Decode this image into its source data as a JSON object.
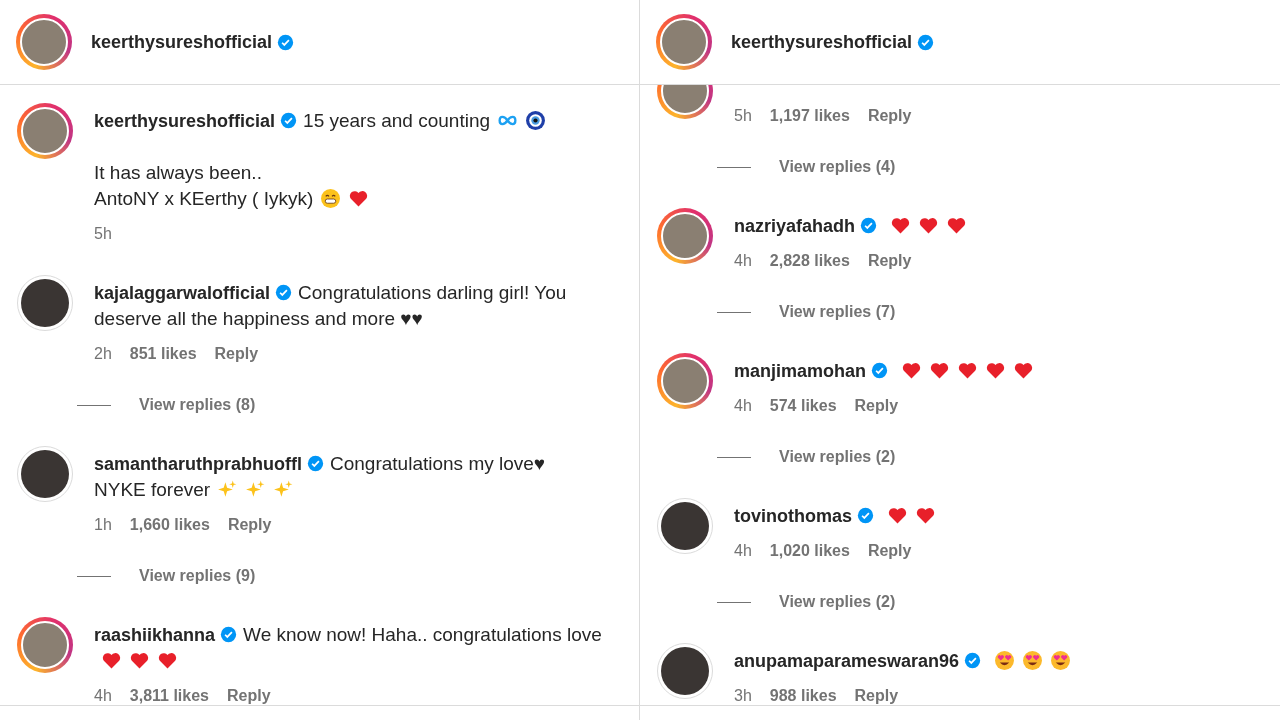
{
  "panels": [
    {
      "header": {
        "username": "keerthysureshofficial",
        "verified": true,
        "story_ring": true
      },
      "clipped_top": false,
      "comments": [
        {
          "username": "keerthysureshofficial",
          "verified": true,
          "story_ring": true,
          "body": [
            {
              "kind": "text",
              "text": "15 years and counting"
            },
            {
              "kind": "infinity"
            },
            {
              "kind": "evil-eye"
            },
            {
              "kind": "break"
            },
            {
              "kind": "break"
            },
            {
              "kind": "text",
              "text": "It has always been.."
            },
            {
              "kind": "break"
            },
            {
              "kind": "text",
              "text": "AntoNY x KEerthy ( Iykyk)"
            },
            {
              "kind": "grin"
            },
            {
              "kind": "heart"
            }
          ],
          "time": "5h"
        },
        {
          "username": "kajalaggarwalofficial",
          "verified": true,
          "story_ring": false,
          "body": [
            {
              "kind": "text",
              "text": "Congratulations darling girl! You deserve all the happiness and more ♥♥"
            }
          ],
          "time": "2h",
          "likes": "851 likes",
          "reply": "Reply",
          "view_replies": "View replies (8)"
        },
        {
          "username": "samantharuthprabhuoffl",
          "verified": true,
          "story_ring": false,
          "body": [
            {
              "kind": "text",
              "text": "Congratulations my love♥"
            },
            {
              "kind": "break"
            },
            {
              "kind": "text",
              "text": "NYKE forever"
            },
            {
              "kind": "sparkles"
            },
            {
              "kind": "sparkles"
            },
            {
              "kind": "sparkles"
            }
          ],
          "time": "1h",
          "likes": "1,660 likes",
          "reply": "Reply",
          "view_replies": "View replies (9)"
        },
        {
          "username": "raashiikhanna",
          "verified": true,
          "story_ring": true,
          "body": [
            {
              "kind": "text",
              "text": "We know now! Haha.. congratulations love"
            },
            {
              "kind": "heart"
            },
            {
              "kind": "heart"
            },
            {
              "kind": "heart"
            }
          ],
          "time": "4h",
          "likes": "3,811 likes",
          "reply": "Reply"
        }
      ]
    },
    {
      "header": {
        "username": "keerthysureshofficial",
        "verified": true,
        "story_ring": true
      },
      "clipped_top": true,
      "comments": [
        {
          "story_ring": true,
          "time": "5h",
          "likes": "1,197 likes",
          "reply": "Reply",
          "view_replies": "View replies (4)"
        },
        {
          "username": "nazriyafahadh",
          "verified": true,
          "story_ring": true,
          "body": [
            {
              "kind": "heart"
            },
            {
              "kind": "heart"
            },
            {
              "kind": "heart"
            }
          ],
          "time": "4h",
          "likes": "2,828 likes",
          "reply": "Reply",
          "view_replies": "View replies (7)"
        },
        {
          "username": "manjimamohan",
          "verified": true,
          "story_ring": true,
          "body": [
            {
              "kind": "heart"
            },
            {
              "kind": "heart"
            },
            {
              "kind": "heart"
            },
            {
              "kind": "heart"
            },
            {
              "kind": "heart"
            }
          ],
          "time": "4h",
          "likes": "574 likes",
          "reply": "Reply",
          "view_replies": "View replies (2)"
        },
        {
          "username": "tovinothomas",
          "verified": true,
          "story_ring": false,
          "body": [
            {
              "kind": "heart"
            },
            {
              "kind": "heart"
            }
          ],
          "time": "4h",
          "likes": "1,020 likes",
          "reply": "Reply",
          "view_replies": "View replies (2)"
        },
        {
          "username": "anupamaparameswaran96",
          "verified": true,
          "story_ring": false,
          "body": [
            {
              "kind": "heart-eyes"
            },
            {
              "kind": "heart-eyes"
            },
            {
              "kind": "heart-eyes"
            }
          ],
          "time": "3h",
          "likes": "988 likes",
          "reply": "Reply"
        }
      ]
    }
  ]
}
